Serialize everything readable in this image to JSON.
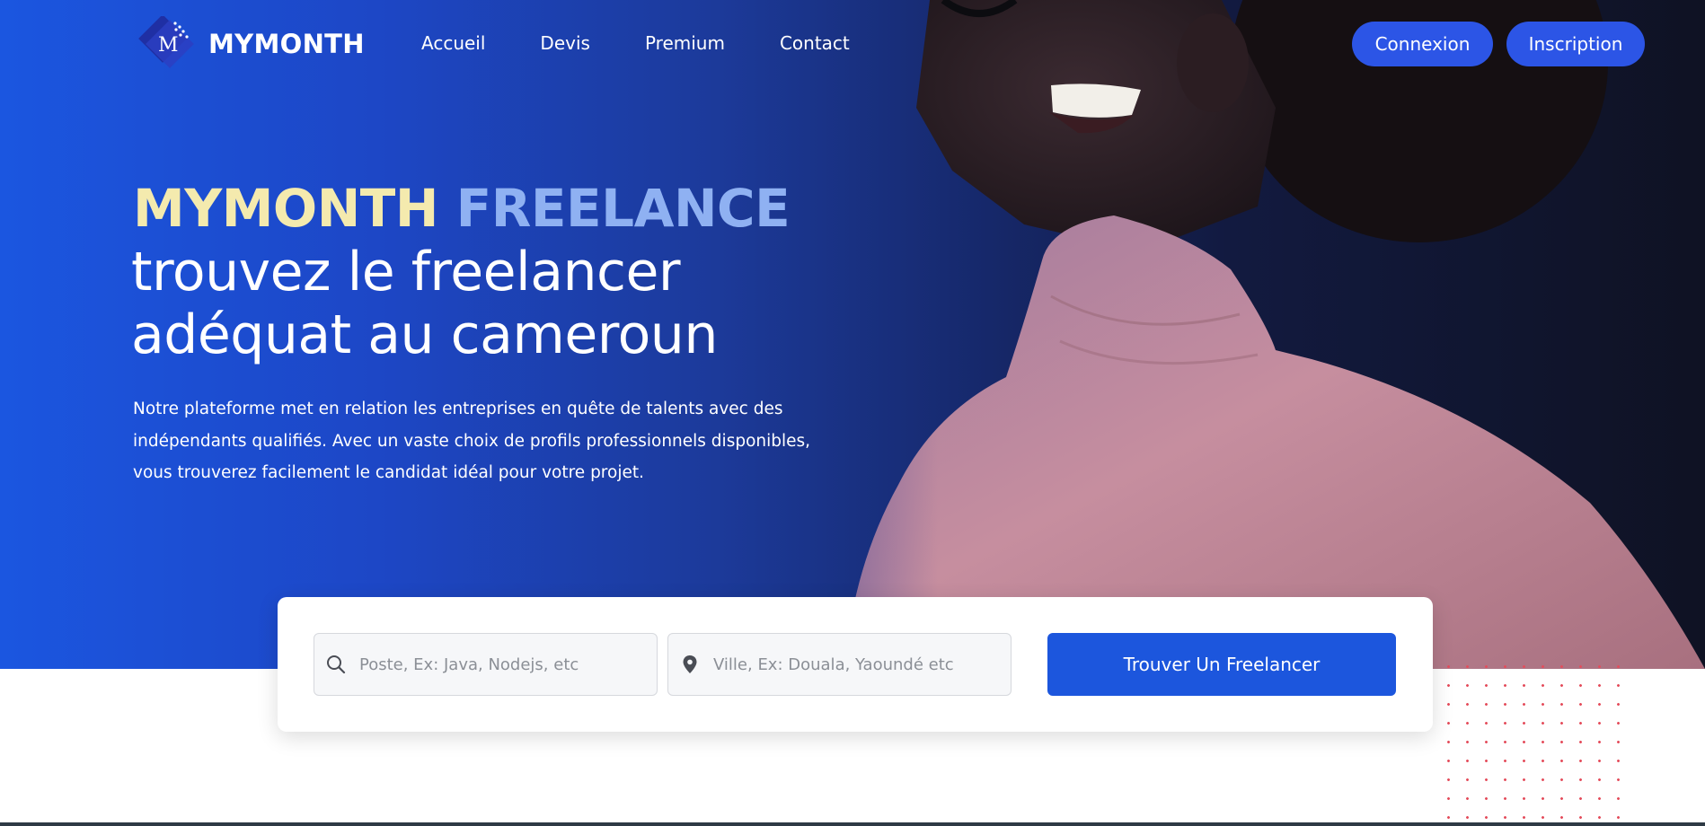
{
  "brand": {
    "name": "MYMONTH",
    "logo_letter": "M"
  },
  "nav": {
    "items": [
      {
        "label": "Accueil"
      },
      {
        "label": "Devis"
      },
      {
        "label": "Premium"
      },
      {
        "label": "Contact"
      }
    ],
    "login_label": "Connexion",
    "signup_label": "Inscription"
  },
  "hero": {
    "title_part1": "MYMONTH",
    "title_part2": "FREELANCE",
    "headline_line1": "trouvez le freelancer",
    "headline_line2": "adéquat au cameroun",
    "description": "Notre plateforme met en relation les entreprises en quête de talents avec des indépendants qualifiés. Avec un vaste choix de profils professionnels disponibles, vous trouverez facilement le candidat idéal pour votre projet.",
    "photo_icon": "smiling-person-photo"
  },
  "search": {
    "job_placeholder": "Poste, Ex: Java, Nodejs, etc",
    "job_value": "",
    "job_icon": "search-icon",
    "city_placeholder": "Ville, Ex: Douala, Yaoundé etc",
    "city_value": "",
    "city_icon": "location-pin-icon",
    "submit_label": "Trouver Un Freelancer"
  },
  "colors": {
    "primary": "#1c56dd",
    "pill_button": "#2c55e6",
    "title_yellow": "#f4eaae",
    "title_blue": "#8fb1f2",
    "dot_pattern": "#e44d5c"
  }
}
